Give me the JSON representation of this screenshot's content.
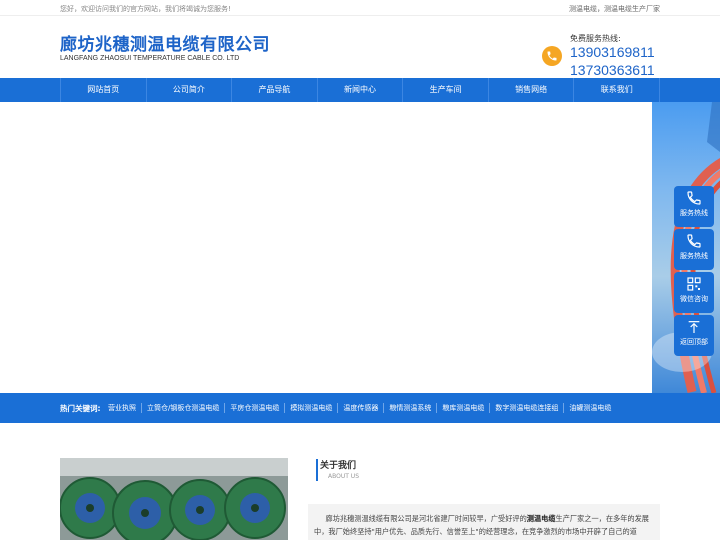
{
  "topbar": {
    "greeting": "您好，欢迎访问我们的官方网站，我们将竭诚为您服务!",
    "links": "测温电缆，测温电缆生产厂家"
  },
  "header": {
    "company_cn": "廊坊兆穗测温电缆有限公司",
    "company_en": "LANGFANG ZHAOSUI TEMPERATURE CABLE CO. LTD",
    "hotline_title": "免费服务热线:",
    "phone_1": "13903169811",
    "phone_2": "13730363611",
    "phone_icon": "phone-icon"
  },
  "nav": {
    "items": [
      {
        "label": "网站首页"
      },
      {
        "label": "公司简介"
      },
      {
        "label": "产品导航"
      },
      {
        "label": "新闻中心"
      },
      {
        "label": "生产车间"
      },
      {
        "label": "销售网络"
      },
      {
        "label": "联系我们"
      }
    ]
  },
  "side_panel": {
    "items": [
      {
        "label": "服务热线",
        "icon": "phone-icon"
      },
      {
        "label": "服务热线",
        "icon": "phone-icon"
      },
      {
        "label": "微信咨询",
        "icon": "qrcode-icon"
      },
      {
        "label": "返回顶部",
        "icon": "arrow-up-icon"
      }
    ]
  },
  "keywords": {
    "label": "热门关键词:",
    "items": [
      "营业执照",
      "立筒仓/钢板仓测温电缆",
      "平房仓测温电缆",
      "模拟测温电缆",
      "温度传感器",
      "粮情测温系统",
      "粮库测温电缆",
      "数字测温电缆连接组",
      "油罐测温电缆"
    ]
  },
  "about": {
    "title": "关于我们",
    "subtitle": "ABOUT US",
    "text_pre": "廊坊兆穗测温线缆有限公司是河北省建厂时间较早，广受好评的",
    "text_bold": "测温电缆",
    "text_post": "生产厂家之一，在多年的发展中，我厂始终坚持\"用户优先、品质先行、信誉至上\"的经营理念，在竞争激烈的市场中开辟了自己的道"
  },
  "colors": {
    "primary": "#1a6fd6",
    "brand_text": "#1e64c8",
    "hotline_icon": "#f5a623"
  }
}
